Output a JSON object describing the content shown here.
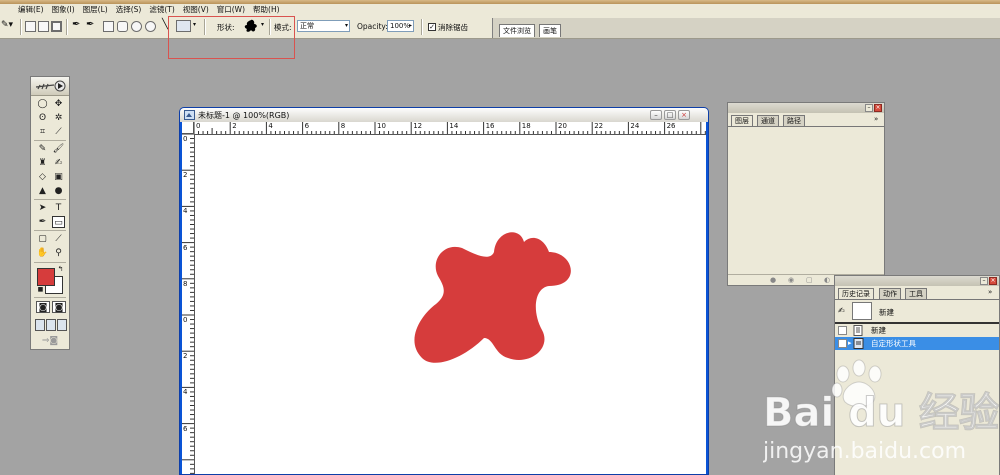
{
  "menu": [
    "编辑(E)",
    "图象(I)",
    "图层(L)",
    "选择(S)",
    "滤镜(T)",
    "视图(V)",
    "窗口(W)",
    "帮助(H)"
  ],
  "options": {
    "shape_label": "形状:",
    "mode_label": "模式:",
    "mode_value": "正常",
    "opacity_label": "Opacity:",
    "opacity_value": "100%",
    "antialias_label": "消除锯齿"
  },
  "palette_well": {
    "tab1": "文件浏览",
    "tab2": "画笔"
  },
  "document": {
    "title": "未标题-1 @ 100%(RGB)",
    "h_ticks": [
      "0",
      "2",
      "4",
      "6",
      "8",
      "10",
      "12",
      "14",
      "16",
      "18",
      "20",
      "22",
      "24",
      "26"
    ],
    "v_ticks": [
      "0",
      "2",
      "4",
      "6",
      "8",
      "0",
      "2",
      "4",
      "6"
    ]
  },
  "layers_palette": {
    "tabs": [
      "图层",
      "通道",
      "路径"
    ]
  },
  "history_palette": {
    "tabs": [
      "历史记录",
      "动作",
      "工具"
    ],
    "snapshot_label": "新建",
    "rows": [
      {
        "label": "新建",
        "selected": false
      },
      {
        "label": "自定形状工具",
        "selected": true
      }
    ]
  },
  "colors": {
    "foreground": "#d63c3c",
    "background": "#ffffff",
    "shape_fill": "#d63c3c"
  },
  "watermark": {
    "brand": "Bai du 经验",
    "url": "jingyan.baidu.com"
  }
}
